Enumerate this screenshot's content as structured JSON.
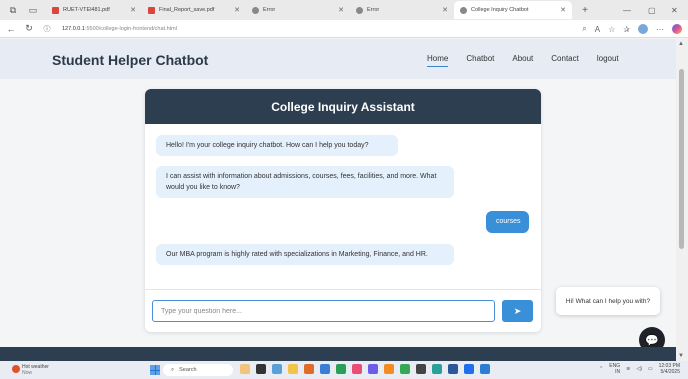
{
  "browser": {
    "tabs": [
      {
        "title": "RUET-VTEl481.pdf",
        "fav_color": "#d9463b"
      },
      {
        "title": "Final_Report_save.pdf",
        "fav_color": "#d9463b"
      },
      {
        "title": "Error",
        "fav_color": "#888888"
      },
      {
        "title": "Error",
        "fav_color": "#888888"
      },
      {
        "title": "College Inquiry Chatbot",
        "fav_color": "#888888"
      }
    ],
    "url_host": "127.0.0.1",
    "url_path": ":5500/college-login-frontend/chat.html"
  },
  "header": {
    "brand": "Student Helper Chatbot",
    "nav": [
      "Home",
      "Chatbot",
      "About",
      "Contact",
      "logout"
    ]
  },
  "chat": {
    "title": "College Inquiry Assistant",
    "messages": [
      {
        "from": "bot",
        "text": "Hello! I'm your college inquiry chatbot. How can I help you today?"
      },
      {
        "from": "bot",
        "text": "I can assist with information about admissions, courses, fees, facilities, and more. What would you like to know?"
      },
      {
        "from": "user",
        "text": "courses"
      },
      {
        "from": "bot",
        "text": "Our MBA program is highly rated with specializations in Marketing, Finance, and HR."
      }
    ],
    "input_placeholder": "Type your question here..."
  },
  "widget": {
    "greeting": "Hi! What can I help you with?"
  },
  "taskbar": {
    "weather_title": "Hot weather",
    "weather_sub": "Now",
    "search_label": "Search",
    "lang": "ENG",
    "lang_sub": "IN",
    "time": "12:03 PM",
    "date": "5/4/2025"
  },
  "colors": {
    "header_bg": "#e6ebf4",
    "chat_header": "#2c3e50",
    "accent": "#3a8fd9",
    "bot_bubble": "#e4f0fb"
  }
}
